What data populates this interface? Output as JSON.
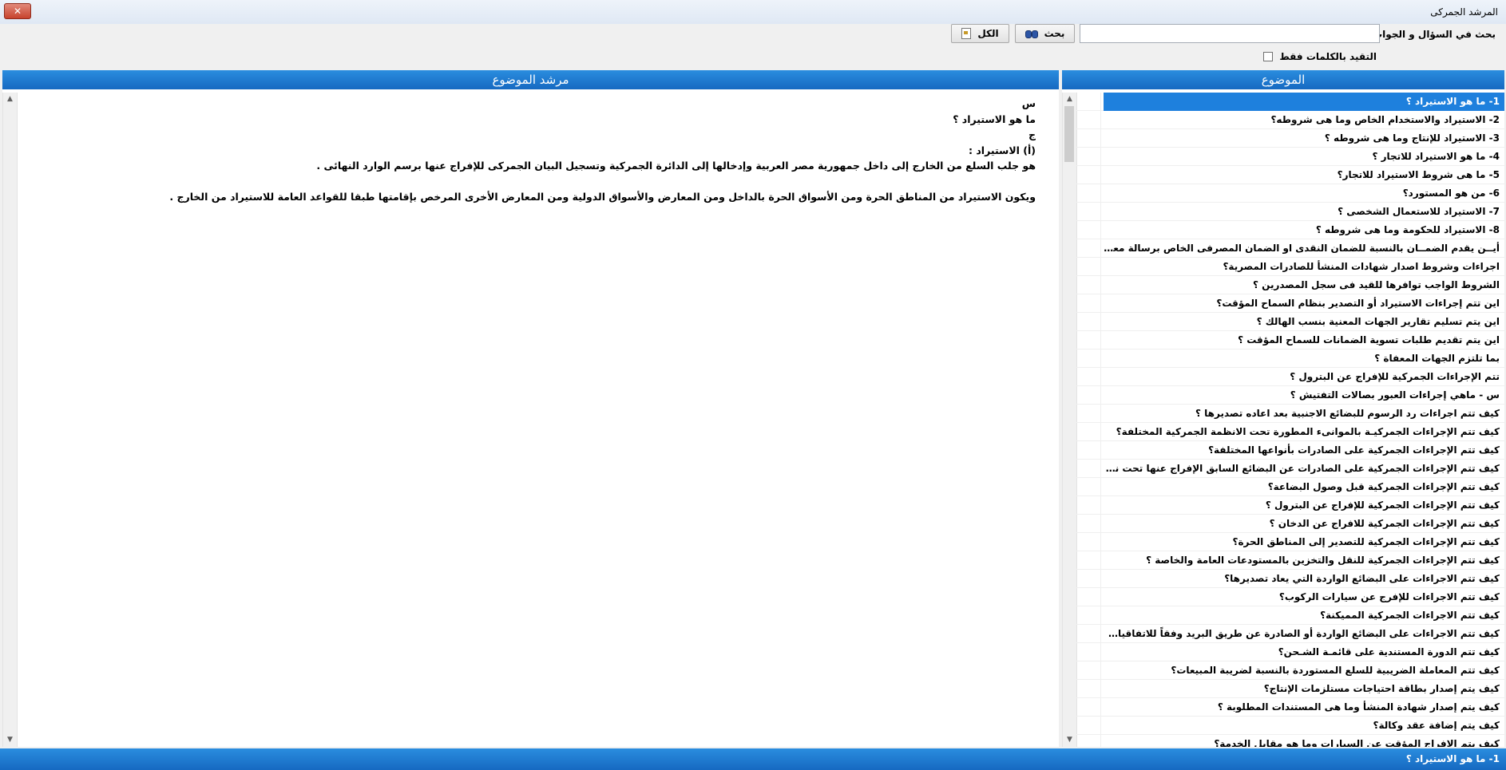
{
  "window": {
    "title": "المرشد الجمركى",
    "close_label": "✕"
  },
  "toolbar": {
    "search_label": "بحث في السؤال و الجواب",
    "search_value": "",
    "search_button": "بحث",
    "all_button": "الكل",
    "exact_words_label": "التقيد بالكلمات فقط"
  },
  "topics_panel": {
    "header": "الموضوع",
    "items": [
      "1- ما هو الاستيراد ؟",
      "2- الاستيراد والاستخدام الخاص وما هى شروطه؟",
      "3- الاستيراد للإنتاج وما هى شروطه ؟",
      "4- ما هو الاستيراد للاتجار ؟",
      "5- ما هى شروط  الاستيراد للاتجار؟",
      "6-  من هو المستورد؟",
      "7- الاستيراد للاستعمال الشخصى ؟",
      "8- الاستيراد للحكومة وما هى شروطه ؟",
      "أيــن يقدم الضمــان بالنسبة للضمان النقدى او الضمان المصرفى الخاص برسالة معينة متمتع بنظام السماح المؤقت؟",
      "اجراءات وشروط اصدار شهادات المنشأ للصادرات المصرية؟",
      "الشروط الواجب توافرها للقيد فى سجل المصدرين ؟",
      "اين تتم  إجراءات الاستيراد أو التصدير بنظام السماح المؤقت؟",
      "اين يتم تسليم تقارير الجهات المعنية بنسب الهالك ؟",
      "اين يتم تقديم طلبات تسوية الضمانات للسماح المؤقت ؟",
      "بما تلتزم الجهات المعفاة ؟",
      "تتم الإجراءات الجمركية للإفراج عن البترول ؟",
      "س - ماهي إجراءات العبور بصالات التفتيش ؟",
      "كيف تتم اجراءات رد الرسوم للبضائع الاجنبية بعد اعاده تصديرها ؟",
      "كيف تتم الإجراءات الجمركيـة بالموانىء المطورة تحت الانظمة الجمركية المختلفة؟",
      "كيف تتم الإجراءات الجمركية على الصادرات بأنواعها المختلفة؟",
      "كيف تتم الإجراءات الجمركية على الصادرات عن البضائع السابق الإفراج عنها تحت نظام الإفراج المؤقت؟",
      "كيف تتم الإجراءات الجمركية قبل وصول البضاعة؟",
      "كيف تتم الإجراءات الجمركية للإفراج عن البترول ؟",
      "كيف تتم الإجراءات الجمركية للافراج عن الدخان ؟",
      "كيف تتم الإجراءات الجمركية للتصدير إلى المناطق الحرة؟",
      "كيف تتم الإجراءات الجمركية للنقل والتخزين بالمستودعات العامة والخاصة ؟",
      "كيف تتم الاجراءات على البضائع الواردة التي يعاد تصديرها؟",
      "كيف تتم الاجراءات للإفرج عن سيارات الركوب؟",
      "كيف تتم الاجراءات الجمركية المميكنة؟",
      "كيف تتم الاجراءات على البضائع الواردة أو الصادرة عن طريق البريد وفقاً للاتفاقيات البريدية الدولية؟",
      "كيف تتم الدورة المستندية على قائمـة الشـحن؟",
      "كيف تتم المعاملة الضريبية للسلع المستوردة بالنسبة لضريبة المبيعات؟",
      "كيف يتم إصدار بطاقة احتياجات مستلزمات الإنتاج؟",
      "كيف يتم إصدار شهادة المنشأ وما هى المستندات المطلوبة ؟",
      "كيف يتم إضافة عقد وكالة؟",
      "كيف يتم الإفراج المؤقت عن السيارات وما هو مقابل الخدمة؟"
    ]
  },
  "content_panel": {
    "header": "مرشد الموضوع",
    "lines": [
      "س",
      "ما هو الاستيراد ؟",
      "ج",
      "(أ) الاستيراد :",
      "هو جلب السلع من الخارج إلى داخل جمهورية مصر العربية وإدخالها إلى الدائرة الجمركية وتسجيل البيان الجمركى للإفراج عنها برسم الوارد النهائى .",
      "",
      "ويكون الاستيراد من المناطق الحرة ومن الأسواق الحرة بالداخل ومن المعارض والأسواق الدولية ومن المعارض الأخرى المرخص بإقامتها طبقا للقواعد العامة للاستيراد من الخارج ."
    ]
  },
  "status": {
    "text": "1- ما هو الاستيراد ؟"
  },
  "colors": {
    "header_blue": "#1e80dd",
    "selection": "#1e80dd"
  }
}
